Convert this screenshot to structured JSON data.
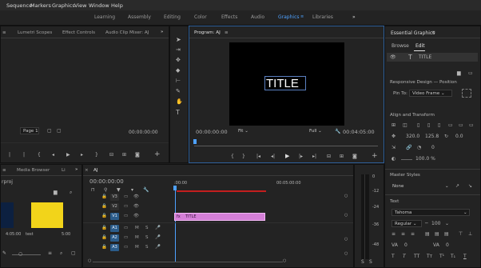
{
  "menu": [
    "Sequence",
    "Markers",
    "Graphics",
    "View",
    "Window",
    "Help"
  ],
  "workspaces": [
    "Learning",
    "Assembly",
    "Editing",
    "Color",
    "Effects",
    "Audio",
    "Graphics",
    "Libraries"
  ],
  "workspace_active": "Graphics",
  "workspace_more": "»",
  "source_tabs": [
    "Lumetri Scopes",
    "Effect Controls",
    "Audio Clip Mixer: AJ"
  ],
  "source_timecode": "00:00:00:00",
  "source_page": "Page 1",
  "program": {
    "tab": "Program: AJ",
    "title_text": "TITLE",
    "timecode": "00:00:00:00",
    "fit": "Fit",
    "quality": "Full",
    "duration": "00:04:05:00"
  },
  "project": {
    "tabs": [
      "Media Browser",
      "Li"
    ],
    "name_fragment": "rproj",
    "thumb_labels": [
      "4:05:00",
      "test",
      "5:00"
    ]
  },
  "timeline": {
    "tab": "AJ",
    "timecode": "00:00:00:00",
    "ruler": [
      ":00:00",
      "00:05:00:00"
    ],
    "clip_label": "TITLE",
    "tracks": [
      "V3",
      "V2",
      "V1",
      "A1",
      "A2",
      "A3"
    ],
    "selected_tracks": [
      "V1",
      "A1",
      "A2",
      "A3"
    ],
    "track_icons": {
      "video": [
        "🔒",
        "▭",
        "👁"
      ],
      "audio": [
        "🔒",
        "▭",
        "M",
        "S",
        "🎤"
      ]
    }
  },
  "meter_scale": [
    "0",
    "-12",
    "-24",
    "-36",
    "-48"
  ],
  "essential": {
    "title": "Essential Graphics",
    "tabs": [
      "Browse",
      "Edit"
    ],
    "active_tab": "Edit",
    "layer_name": "TITLE",
    "responsive_label": "Responsive Design — Position",
    "pin_to_label": "Pin To:",
    "pin_to_value": "Video Frame",
    "align_label": "Align and Transform",
    "pos_x": "320.0",
    "pos_y": "125.8",
    "rotation": "0.0",
    "scale": "100.0 %",
    "master_styles_label": "Master Styles",
    "master_styles_value": "None",
    "text_label": "Text",
    "font": "Tahoma",
    "font_style": "Regular",
    "font_size": "100"
  },
  "colors": {
    "accent": "#4ea1ff",
    "title_clip": "#d57fd8",
    "audio_selected": "#2b5c8a",
    "in_out_bar": "#c41e1e",
    "thumb_yellow": "#f2d41a"
  }
}
